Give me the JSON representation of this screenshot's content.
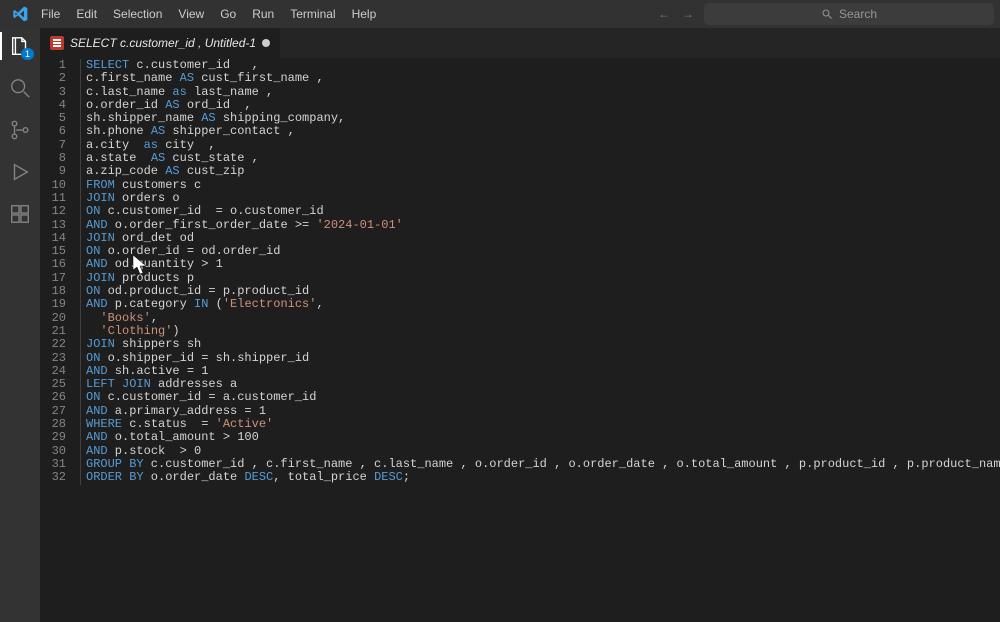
{
  "menu": [
    "File",
    "Edit",
    "Selection",
    "View",
    "Go",
    "Run",
    "Terminal",
    "Help"
  ],
  "search_placeholder": "Search",
  "tab": {
    "title": "SELECT c.customer_id , Untitled-1"
  },
  "badge": "1",
  "code": [
    [
      [
        "kw",
        "SELECT"
      ],
      [
        "plain",
        " c.customer_id   ,"
      ]
    ],
    [
      [
        "plain",
        "c.first_name "
      ],
      [
        "kw",
        "AS"
      ],
      [
        "plain",
        " cust_first_name ,"
      ]
    ],
    [
      [
        "plain",
        "c.last_name "
      ],
      [
        "kw",
        "as"
      ],
      [
        "plain",
        " last_name ,"
      ]
    ],
    [
      [
        "plain",
        "o.order_id "
      ],
      [
        "kw",
        "AS"
      ],
      [
        "plain",
        " ord_id  ,"
      ]
    ],
    [
      [
        "plain",
        "sh.shipper_name "
      ],
      [
        "kw",
        "AS"
      ],
      [
        "plain",
        " shipping_company,"
      ]
    ],
    [
      [
        "plain",
        "sh.phone "
      ],
      [
        "kw",
        "AS"
      ],
      [
        "plain",
        " shipper_contact ,"
      ]
    ],
    [
      [
        "plain",
        "a.city  "
      ],
      [
        "kw",
        "as"
      ],
      [
        "plain",
        " city  ,"
      ]
    ],
    [
      [
        "plain",
        "a.state  "
      ],
      [
        "kw",
        "AS"
      ],
      [
        "plain",
        " cust_state ,"
      ]
    ],
    [
      [
        "plain",
        "a.zip_code "
      ],
      [
        "kw",
        "AS"
      ],
      [
        "plain",
        " cust_zip"
      ]
    ],
    [
      [
        "kw",
        "FROM"
      ],
      [
        "plain",
        " customers c"
      ]
    ],
    [
      [
        "kw",
        "JOIN"
      ],
      [
        "plain",
        " orders o"
      ]
    ],
    [
      [
        "kw",
        "ON"
      ],
      [
        "plain",
        " c.customer_id  = o.customer_id"
      ]
    ],
    [
      [
        "kw",
        "AND"
      ],
      [
        "plain",
        " o.order_first_order_date >= "
      ],
      [
        "str",
        "'2024-01-01'"
      ]
    ],
    [
      [
        "kw",
        "JOIN"
      ],
      [
        "plain",
        " ord_det od"
      ]
    ],
    [
      [
        "kw",
        "ON"
      ],
      [
        "plain",
        " o.order_id = od.order_id"
      ]
    ],
    [
      [
        "kw",
        "AND"
      ],
      [
        "plain",
        " od.quantity > "
      ],
      [
        "plain",
        "1"
      ]
    ],
    [
      [
        "kw",
        "JOIN"
      ],
      [
        "plain",
        " products p"
      ]
    ],
    [
      [
        "kw",
        "ON"
      ],
      [
        "plain",
        " od.product_id = p.product_id"
      ]
    ],
    [
      [
        "kw",
        "AND"
      ],
      [
        "plain",
        " p.category "
      ],
      [
        "kw",
        "IN"
      ],
      [
        "plain",
        " ("
      ],
      [
        "str",
        "'Electronics'"
      ],
      [
        "plain",
        ","
      ]
    ],
    [
      [
        "plain",
        "  "
      ],
      [
        "str",
        "'Books'"
      ],
      [
        "plain",
        ","
      ]
    ],
    [
      [
        "plain",
        "  "
      ],
      [
        "str",
        "'Clothing'"
      ],
      [
        "plain",
        ")"
      ]
    ],
    [
      [
        "kw",
        "JOIN"
      ],
      [
        "plain",
        " shippers sh"
      ]
    ],
    [
      [
        "kw",
        "ON"
      ],
      [
        "plain",
        " o.shipper_id = sh.shipper_id"
      ]
    ],
    [
      [
        "kw",
        "AND"
      ],
      [
        "plain",
        " sh.active = "
      ],
      [
        "plain",
        "1"
      ]
    ],
    [
      [
        "kw",
        "LEFT JOIN"
      ],
      [
        "plain",
        " addresses a"
      ]
    ],
    [
      [
        "kw",
        "ON"
      ],
      [
        "plain",
        " c.customer_id = a.customer_id"
      ]
    ],
    [
      [
        "kw",
        "AND"
      ],
      [
        "plain",
        " a.primary_address = "
      ],
      [
        "plain",
        "1"
      ]
    ],
    [
      [
        "kw",
        "WHERE"
      ],
      [
        "plain",
        " c.status  = "
      ],
      [
        "str",
        "'Active'"
      ]
    ],
    [
      [
        "kw",
        "AND"
      ],
      [
        "plain",
        " o.total_amount > "
      ],
      [
        "plain",
        "100"
      ]
    ],
    [
      [
        "kw",
        "AND"
      ],
      [
        "plain",
        " p.stock  > "
      ],
      [
        "plain",
        "0"
      ]
    ],
    [
      [
        "kw",
        "GROUP BY"
      ],
      [
        "plain",
        " c.customer_id , c.first_name , c.last_name , o.order_id , o.order_date , o.total_amount , p.product_id , p.product_name , p.category , od.quantity , od.unit_price"
      ]
    ],
    [
      [
        "kw",
        "ORDER BY"
      ],
      [
        "plain",
        " o.order_date "
      ],
      [
        "kw",
        "DESC"
      ],
      [
        "plain",
        ", total_price "
      ],
      [
        "kw",
        "DESC"
      ],
      [
        "plain",
        ";"
      ]
    ]
  ]
}
